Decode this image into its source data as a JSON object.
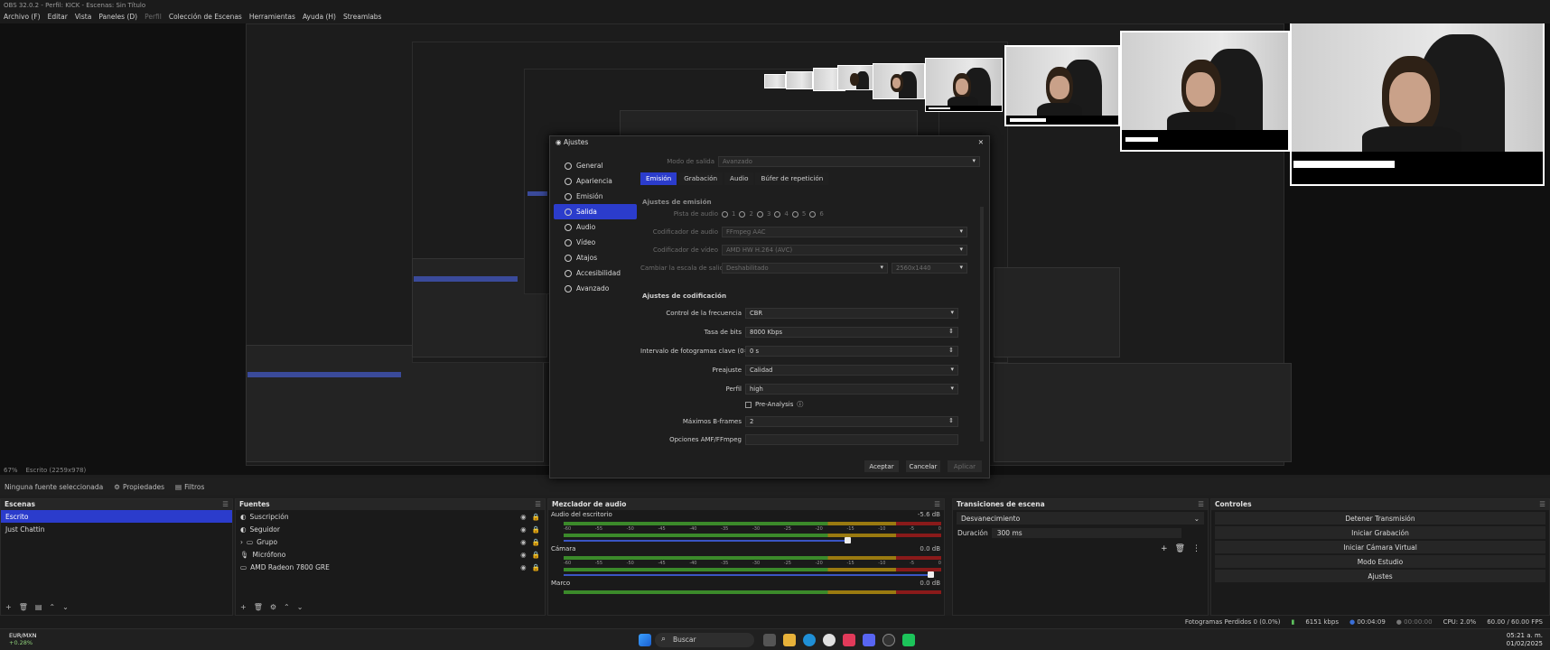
{
  "window": {
    "title": "OBS 32.0.2 - Perfil: KICK - Escenas: Sin Título"
  },
  "menu": [
    "Archivo (F)",
    "Editar",
    "Vista",
    "Paneles (D)",
    "Perfil",
    "Colección de Escenas",
    "Herramientas",
    "Ayuda (H)",
    "Streamlabs"
  ],
  "preview": {
    "zoom_label": "67%",
    "scene_label": "Escrito (2259x978)"
  },
  "source_toolbar": {
    "none_selected": "Ninguna fuente seleccionada",
    "properties": "Propiedades",
    "filters": "Filtros"
  },
  "scenes": {
    "title": "Escenas",
    "items": [
      "Escrito",
      "Just Chattin"
    ],
    "selected": 0
  },
  "sources": {
    "title": "Fuentes",
    "items": [
      "Suscripción",
      "Seguidor",
      "Grupo",
      "Micrófono",
      "AMD Radeon 7800 GRE"
    ]
  },
  "mixer": {
    "title": "Mezclador de audio",
    "channels": [
      {
        "name": "Audio del escritorio",
        "db": "-5.6 dB"
      },
      {
        "name": "Cámara",
        "db": "0.0 dB"
      },
      {
        "name": "Marco",
        "db": "0.0 dB"
      }
    ],
    "ticks": [
      "-60",
      "-55",
      "-50",
      "-45",
      "-40",
      "-35",
      "-30",
      "-25",
      "-20",
      "-15",
      "-10",
      "-5",
      "0"
    ]
  },
  "transitions": {
    "title": "Transiciones de escena",
    "selected": "Desvanecimiento",
    "duration_label": "Duración",
    "duration_value": "300 ms"
  },
  "controls": {
    "title": "Controles",
    "buttons": [
      "Detener Transmisión",
      "Iniciar Grabación",
      "Iniciar Cámara Virtual",
      "Modo Estudio",
      "Ajustes"
    ]
  },
  "statusbar": {
    "dropped": "Fotogramas Perdidos 0 (0.0%)",
    "kbps": "6151 kbps",
    "live_time": "00:04:09",
    "rec_time": "00:00:00",
    "cpu": "CPU: 2.0%",
    "fps": "60.00 / 60.00 FPS"
  },
  "taskbar": {
    "search": "Buscar",
    "clock_time": "05:21 a. m.",
    "clock_date": "01/02/2025",
    "weather_title": "EUR/MXN",
    "weather_value": "+0.28%"
  },
  "settings": {
    "title": "Ajustes",
    "sidebar": [
      "General",
      "Apariencia",
      "Emisión",
      "Salida",
      "Audio",
      "Vídeo",
      "Atajos",
      "Accesibilidad",
      "Avanzado"
    ],
    "selected": 3,
    "output_mode_label": "Modo de salida",
    "output_mode_value": "Avanzado",
    "tabs": [
      "Emisión",
      "Grabación",
      "Audio",
      "Búfer de repetición"
    ],
    "section1": "Ajustes de emisión",
    "audio_track_label": "Pista de audio",
    "tracks": [
      "1",
      "2",
      "3",
      "4",
      "5",
      "6"
    ],
    "audio_encoder_label": "Codificador de audio",
    "audio_encoder_value": "FFmpeg AAC",
    "video_encoder_label": "Codificador de vídeo",
    "video_encoder_value": "AMD HW H.264 (AVC)",
    "rescale_label": "Cambiar la escala de salida",
    "rescale_value": "Deshabilitado",
    "rescale_res": "2560x1440",
    "section2": "Ajustes de codificación",
    "rate_control_label": "Control de la frecuencia",
    "rate_control_value": "CBR",
    "bitrate_label": "Tasa de bits",
    "bitrate_value": "8000 Kbps",
    "keyint_label": "Intervalo de fotogramas clave (0=auto)",
    "keyint_value": "0 s",
    "preset_label": "Preajuste",
    "preset_value": "Calidad",
    "profile_label": "Perfil",
    "profile_value": "high",
    "preanalysis_label": "Pre-Analysis",
    "bframes_label": "Máximos B-frames",
    "bframes_value": "2",
    "ffmpeg_label": "Opciones AMF/FFmpeg",
    "ffmpeg_value": "",
    "ok": "Aceptar",
    "cancel": "Cancelar",
    "apply": "Aplicar"
  }
}
